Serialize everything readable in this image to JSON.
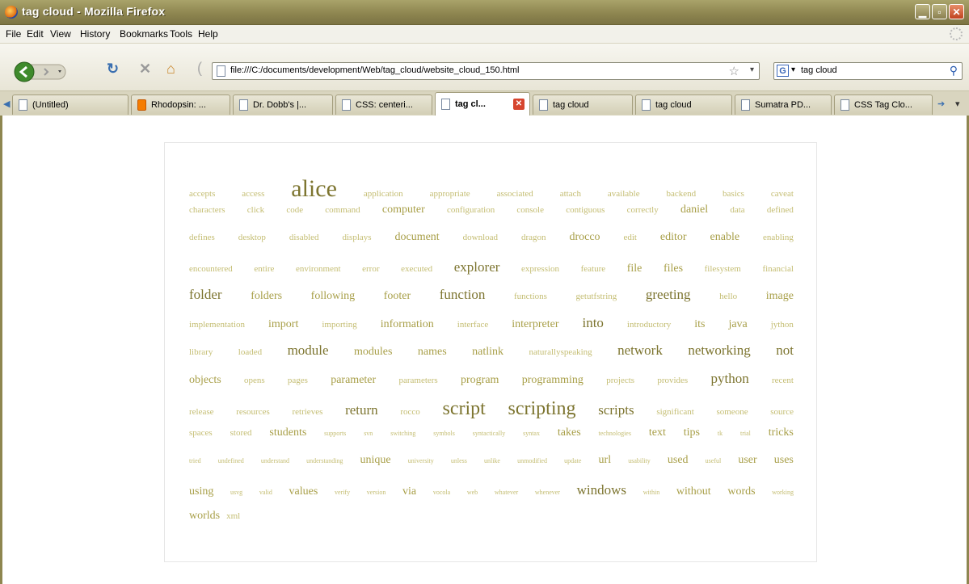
{
  "window": {
    "title": "tag cloud - Mozilla Firefox"
  },
  "menu": [
    "File",
    "Edit",
    "View",
    "History",
    "Bookmarks",
    "Tools",
    "Help"
  ],
  "nav": {
    "url": "file:///C:/documents/development/Web/tag_cloud/website_cloud_150.html"
  },
  "search": {
    "value": "tag cloud",
    "engine_icon": "G"
  },
  "tabs": [
    {
      "label": "(Untitled)",
      "icon": "page-icon"
    },
    {
      "label": "Rhodopsin: ...",
      "icon": "blogger-icon"
    },
    {
      "label": "Dr. Dobb's |...",
      "icon": "page-icon"
    },
    {
      "label": "CSS: centeri...",
      "icon": "page-icon"
    },
    {
      "label": "tag cl...",
      "icon": "page-icon",
      "active": true
    },
    {
      "label": "tag cloud",
      "icon": "page-icon"
    },
    {
      "label": "tag cloud",
      "icon": "page-icon"
    },
    {
      "label": "Sumatra PD...",
      "icon": "page-icon"
    },
    {
      "label": "CSS Tag Clo...",
      "icon": "page-icon"
    }
  ],
  "cloud": [
    {
      "w": "accepts",
      "s": 1
    },
    {
      "w": "access",
      "s": 1
    },
    {
      "w": "alice",
      "s": 6
    },
    {
      "w": "application",
      "s": 1
    },
    {
      "w": "appropriate",
      "s": 1
    },
    {
      "w": "associated",
      "s": 1
    },
    {
      "w": "attach",
      "s": 1
    },
    {
      "w": "available",
      "s": 1
    },
    {
      "w": "backend",
      "s": 1
    },
    {
      "w": "basics",
      "s": 1
    },
    {
      "w": "caveat",
      "s": 1
    },
    {
      "w": "characters",
      "s": 1
    },
    {
      "w": "click",
      "s": 1
    },
    {
      "w": "code",
      "s": 1
    },
    {
      "w": "command",
      "s": 1
    },
    {
      "w": "computer",
      "s": 2
    },
    {
      "w": "configuration",
      "s": 1
    },
    {
      "w": "console",
      "s": 1
    },
    {
      "w": "contiguous",
      "s": 1
    },
    {
      "w": "correctly",
      "s": 1
    },
    {
      "w": "daniel",
      "s": 2
    },
    {
      "w": "data",
      "s": 1
    },
    {
      "w": "defined",
      "s": 1
    },
    {
      "w": "defines",
      "s": 1
    },
    {
      "w": "desktop",
      "s": 1
    },
    {
      "w": "disabled",
      "s": 1
    },
    {
      "w": "displays",
      "s": 1
    },
    {
      "w": "document",
      "s": 2
    },
    {
      "w": "download",
      "s": 1
    },
    {
      "w": "dragon",
      "s": 1
    },
    {
      "w": "drocco",
      "s": 2
    },
    {
      "w": "edit",
      "s": 1
    },
    {
      "w": "editor",
      "s": 2
    },
    {
      "w": "enable",
      "s": 2
    },
    {
      "w": "enabling",
      "s": 1
    },
    {
      "w": "encountered",
      "s": 1
    },
    {
      "w": "entire",
      "s": 1
    },
    {
      "w": "environment",
      "s": 1
    },
    {
      "w": "error",
      "s": 1
    },
    {
      "w": "executed",
      "s": 1
    },
    {
      "w": "explorer",
      "s": 3
    },
    {
      "w": "expression",
      "s": 1
    },
    {
      "w": "feature",
      "s": 1
    },
    {
      "w": "file",
      "s": 2
    },
    {
      "w": "files",
      "s": 2
    },
    {
      "w": "filesystem",
      "s": 1
    },
    {
      "w": "financial",
      "s": 1
    },
    {
      "w": "folder",
      "s": 3
    },
    {
      "w": "folders",
      "s": 2
    },
    {
      "w": "following",
      "s": 2
    },
    {
      "w": "footer",
      "s": 2
    },
    {
      "w": "function",
      "s": 3
    },
    {
      "w": "functions",
      "s": 1
    },
    {
      "w": "getutfstring",
      "s": 1
    },
    {
      "w": "greeting",
      "s": 3
    },
    {
      "w": "hello",
      "s": 1
    },
    {
      "w": "image",
      "s": 2
    },
    {
      "w": "implementation",
      "s": 1
    },
    {
      "w": "import",
      "s": 2
    },
    {
      "w": "importing",
      "s": 1
    },
    {
      "w": "information",
      "s": 2
    },
    {
      "w": "interface",
      "s": 1
    },
    {
      "w": "interpreter",
      "s": 2
    },
    {
      "w": "into",
      "s": 3
    },
    {
      "w": "introductory",
      "s": 1
    },
    {
      "w": "its",
      "s": 2
    },
    {
      "w": "java",
      "s": 2
    },
    {
      "w": "jython",
      "s": 1
    },
    {
      "w": "library",
      "s": 1
    },
    {
      "w": "loaded",
      "s": 1
    },
    {
      "w": "module",
      "s": 3
    },
    {
      "w": "modules",
      "s": 2
    },
    {
      "w": "names",
      "s": 2
    },
    {
      "w": "natlink",
      "s": 2
    },
    {
      "w": "naturallyspeaking",
      "s": 1
    },
    {
      "w": "network",
      "s": 3
    },
    {
      "w": "networking",
      "s": 3
    },
    {
      "w": "not",
      "s": 3
    },
    {
      "w": "objects",
      "s": 2
    },
    {
      "w": "opens",
      "s": 1
    },
    {
      "w": "pages",
      "s": 1
    },
    {
      "w": "parameter",
      "s": 2
    },
    {
      "w": "parameters",
      "s": 1
    },
    {
      "w": "program",
      "s": 2
    },
    {
      "w": "programming",
      "s": 2
    },
    {
      "w": "projects",
      "s": 1
    },
    {
      "w": "provides",
      "s": 1
    },
    {
      "w": "python",
      "s": 3
    },
    {
      "w": "recent",
      "s": 1
    },
    {
      "w": "release",
      "s": 1
    },
    {
      "w": "resources",
      "s": 1
    },
    {
      "w": "retrieves",
      "s": 1
    },
    {
      "w": "return",
      "s": 3
    },
    {
      "w": "rocco",
      "s": 1
    },
    {
      "w": "script",
      "s": 5
    },
    {
      "w": "scripting",
      "s": 5
    },
    {
      "w": "scripts",
      "s": 3
    },
    {
      "w": "significant",
      "s": 1
    },
    {
      "w": "someone",
      "s": 1
    },
    {
      "w": "source",
      "s": 1
    },
    {
      "w": "spaces",
      "s": 1
    },
    {
      "w": "stored",
      "s": 1
    },
    {
      "w": "students",
      "s": 2
    },
    {
      "w": "supports",
      "s": 0
    },
    {
      "w": "svn",
      "s": 0
    },
    {
      "w": "switching",
      "s": 0
    },
    {
      "w": "symbols",
      "s": 0
    },
    {
      "w": "syntactically",
      "s": 0
    },
    {
      "w": "syntax",
      "s": 0
    },
    {
      "w": "takes",
      "s": 2
    },
    {
      "w": "technologies",
      "s": 0
    },
    {
      "w": "text",
      "s": 2
    },
    {
      "w": "tips",
      "s": 2
    },
    {
      "w": "tk",
      "s": 0
    },
    {
      "w": "trial",
      "s": 0
    },
    {
      "w": "tricks",
      "s": 2
    },
    {
      "w": "tried",
      "s": 0
    },
    {
      "w": "undefined",
      "s": 0
    },
    {
      "w": "understand",
      "s": 0
    },
    {
      "w": "understanding",
      "s": 0
    },
    {
      "w": "unique",
      "s": 2
    },
    {
      "w": "university",
      "s": 0
    },
    {
      "w": "unless",
      "s": 0
    },
    {
      "w": "unlike",
      "s": 0
    },
    {
      "w": "unmodified",
      "s": 0
    },
    {
      "w": "update",
      "s": 0
    },
    {
      "w": "url",
      "s": 2
    },
    {
      "w": "usability",
      "s": 0
    },
    {
      "w": "used",
      "s": 2
    },
    {
      "w": "useful",
      "s": 0
    },
    {
      "w": "user",
      "s": 2
    },
    {
      "w": "uses",
      "s": 2
    },
    {
      "w": "using",
      "s": 2
    },
    {
      "w": "usvg",
      "s": 0
    },
    {
      "w": "valid",
      "s": 0
    },
    {
      "w": "values",
      "s": 2
    },
    {
      "w": "verify",
      "s": 0
    },
    {
      "w": "version",
      "s": 0
    },
    {
      "w": "via",
      "s": 2
    },
    {
      "w": "vocola",
      "s": 0
    },
    {
      "w": "web",
      "s": 0
    },
    {
      "w": "whatever",
      "s": 0
    },
    {
      "w": "whenever",
      "s": 0
    },
    {
      "w": "windows",
      "s": 3
    },
    {
      "w": "within",
      "s": 0
    },
    {
      "w": "without",
      "s": 2
    },
    {
      "w": "words",
      "s": 2
    },
    {
      "w": "working",
      "s": 0
    },
    {
      "w": "worlds",
      "s": 2
    },
    {
      "w": "xml",
      "s": 1
    }
  ],
  "colors": {
    "tag_light": "#c4bd72",
    "tag_mid": "#a89f48",
    "tag_dark": "#7d7530",
    "title_bar": "#8e8650"
  }
}
